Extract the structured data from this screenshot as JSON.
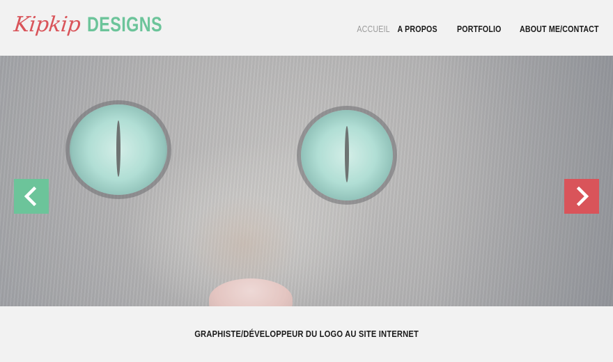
{
  "logo": {
    "script": "Kipkip",
    "word": "DESIGNS"
  },
  "nav": {
    "items": [
      {
        "label": "ACCUEIL",
        "active": true
      },
      {
        "label": "A PROPOS",
        "active": false
      },
      {
        "label": "PORTFOLIO",
        "active": false
      },
      {
        "label": "ABOUT ME/CONTACT",
        "active": false
      }
    ]
  },
  "hero": {
    "prev_icon": "chevron-left-icon",
    "next_icon": "chevron-right-icon"
  },
  "tagline": "GRAPHISTE/DÉVELOPPEUR DU LOGO AU SITE INTERNET",
  "colors": {
    "green": "#6cc49a",
    "red": "#d9545a",
    "bg": "#f2f2f2"
  }
}
